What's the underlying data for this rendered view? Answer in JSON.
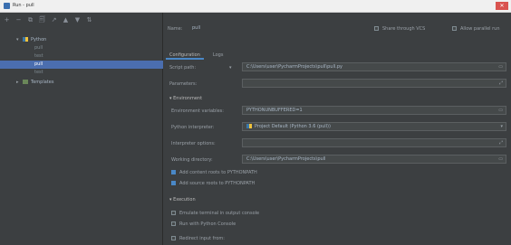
{
  "window": {
    "title": "Run - pull",
    "close_glyph": "✕"
  },
  "toolbar": {
    "buttons": [
      "+",
      "−",
      "⧉",
      "🗐",
      "↗",
      "▲",
      "▼",
      "⇅"
    ]
  },
  "sidebar": {
    "items": [
      {
        "label": "Python",
        "kind": "group"
      },
      {
        "label": "pull",
        "kind": "child"
      },
      {
        "label": "test",
        "kind": "child"
      },
      {
        "label": "pull",
        "kind": "child",
        "selected": true
      },
      {
        "label": "test",
        "kind": "child"
      },
      {
        "label": "Templates",
        "kind": "group"
      }
    ]
  },
  "header": {
    "name_label": "Name:",
    "name_value": "pull",
    "share_label": "Share through VCS",
    "parallel_label": "Allow parallel run"
  },
  "tabs": [
    "Configuration",
    "Logs"
  ],
  "form": {
    "script_path_label": "Script path:",
    "script_path_value": "C:\\Users\\user\\PycharmProjects\\pull\\pull.py",
    "parameters_label": "Parameters:",
    "parameters_value": "",
    "environment_section": "Environment",
    "env_vars_label": "Environment variables:",
    "env_vars_value": "PYTHONUNBUFFERED=1",
    "interpreter_label": "Python interpreter:",
    "interpreter_value": "Project Default (Python 3.6 (pull))",
    "interpreter_options_label": "Interpreter options:",
    "interpreter_options_value": "",
    "working_dir_label": "Working directory:",
    "working_dir_value": "C:\\Users\\user\\PycharmProjects\\pull",
    "add_content_roots": "Add content roots to PYTHONPATH",
    "add_source_roots": "Add source roots to PYTHONPATH",
    "execution_section": "Execution",
    "emulate_terminal": "Emulate terminal in output console",
    "run_console": "Run with Python Console",
    "redirect_input": "Redirect input from:"
  }
}
